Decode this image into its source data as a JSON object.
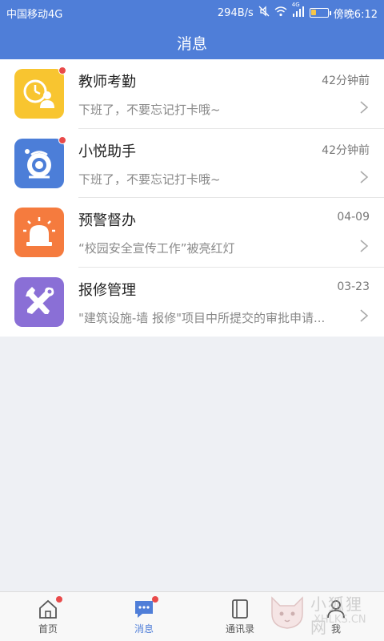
{
  "status_bar": {
    "carrier": "中国移动4G",
    "speed": "294B/s",
    "network_type": "4G",
    "time": "傍晚6:12",
    "battery_level": 0.3
  },
  "header": {
    "title": "消息"
  },
  "messages": [
    {
      "title": "教师考勤",
      "time": "42分钟前",
      "desc": "下班了，不要忘记打卡哦~",
      "icon": "attendance-clock-icon",
      "color": "#f8c530",
      "unread": true
    },
    {
      "title": "小悦助手",
      "time": "42分钟前",
      "desc": "下班了，不要忘记打卡哦~",
      "icon": "assistant-robot-icon",
      "color": "#4c7ed8",
      "unread": true
    },
    {
      "title": "预警督办",
      "time": "04-09",
      "desc": "“校园安全宣传工作”被亮红灯",
      "icon": "alarm-light-icon",
      "color": "#f57b3e",
      "unread": false
    },
    {
      "title": "报修管理",
      "time": "03-23",
      "desc": "\"建筑设施-墙 报修\"项目中所提交的审批申请...",
      "icon": "repair-tools-icon",
      "color": "#8a6fd6",
      "unread": false
    }
  ],
  "tabs": [
    {
      "label": "首页",
      "icon": "home-icon",
      "badge": true
    },
    {
      "label": "消息",
      "icon": "message-icon",
      "badge": true,
      "active": true
    },
    {
      "label": "通讯录",
      "icon": "contacts-book-icon",
      "badge": false
    },
    {
      "label": "我",
      "icon": "profile-icon",
      "badge": false
    }
  ],
  "watermark": {
    "text": "小狐狸网",
    "url": "XHLKS.CN"
  }
}
